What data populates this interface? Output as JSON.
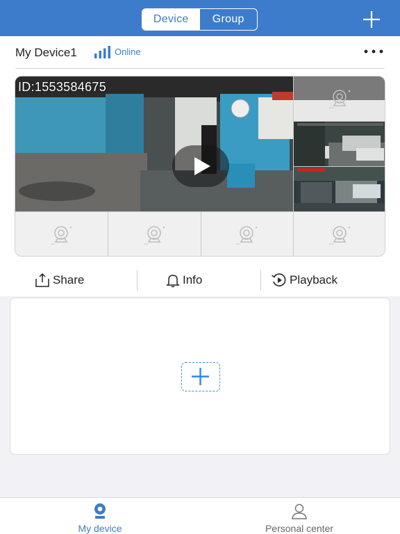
{
  "header": {
    "tabs": [
      {
        "label": "Device",
        "active": true
      },
      {
        "label": "Group",
        "active": false
      }
    ],
    "add_icon": "plus-icon",
    "accent": "#3d7ccb"
  },
  "device": {
    "name": "My Device1",
    "status": "Online",
    "signal_icon": "signal-bars-icon",
    "more_icon": "more-dots-icon",
    "camera_id": "ID:1553584675",
    "play_icon": "play-icon",
    "empty_slot_icon": "camera-icon",
    "empty_slot_count": 5,
    "live_thumbnails": 2
  },
  "actions": [
    {
      "label": "Share",
      "icon": "share-icon"
    },
    {
      "label": "Info",
      "icon": "bell-icon"
    },
    {
      "label": "Playback",
      "icon": "playback-icon"
    }
  ],
  "add_device": {
    "icon": "plus-icon"
  },
  "tabbar": {
    "items": [
      {
        "label": "My device",
        "icon": "camera-tab-icon",
        "active": true
      },
      {
        "label": "Personal center",
        "icon": "person-icon",
        "active": false
      }
    ],
    "active_color": "#3d7ccb",
    "inactive_color": "#666666"
  }
}
